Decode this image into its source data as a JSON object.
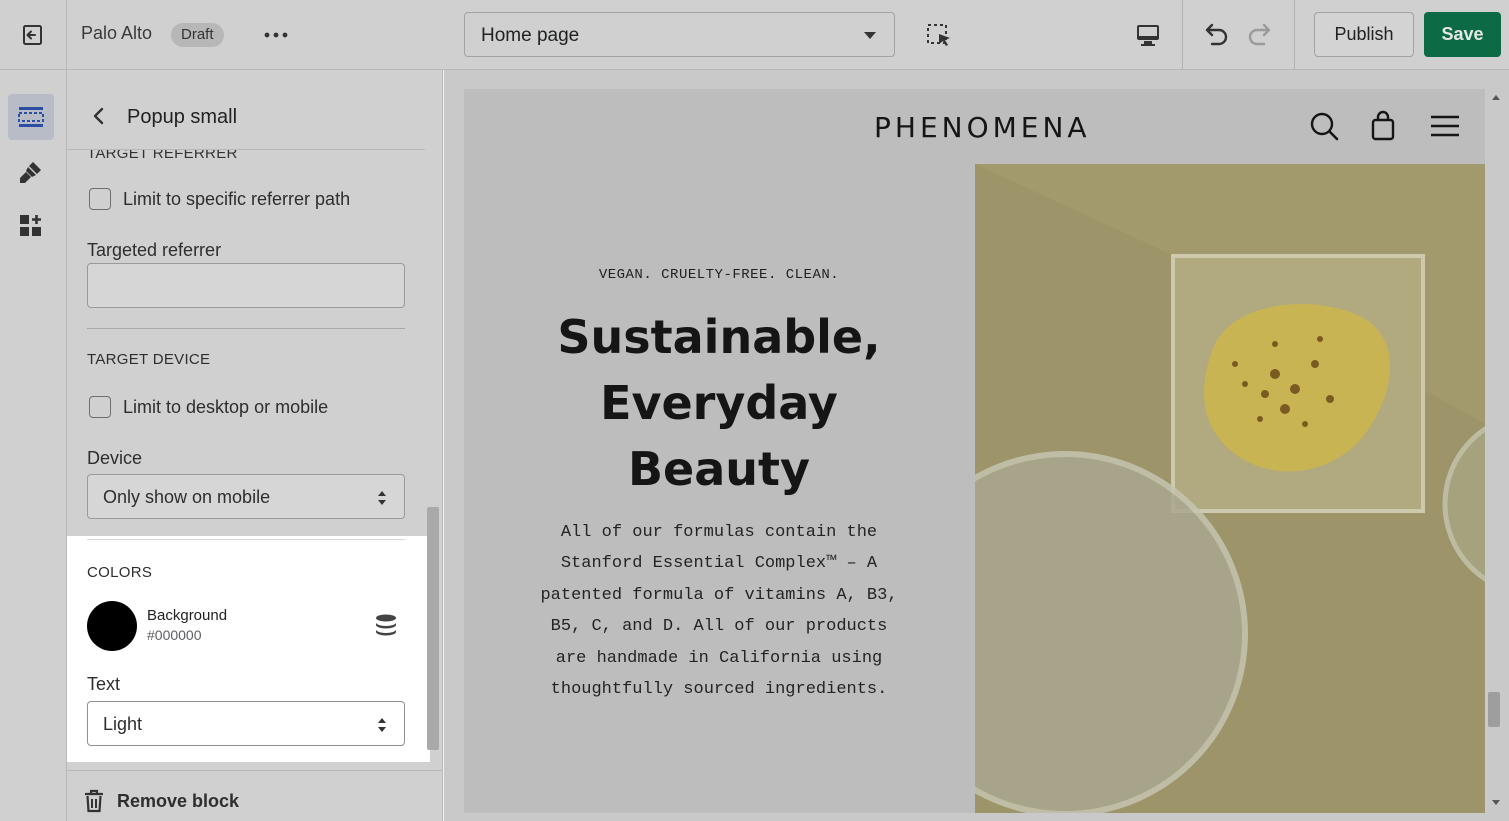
{
  "topbar": {
    "store_name": "Palo Alto",
    "status_badge": "Draft",
    "more_label": "•••",
    "page_selector": "Home page",
    "publish_label": "Publish",
    "save_label": "Save"
  },
  "leftrail": {
    "items": [
      "sections",
      "theme-settings",
      "app-embeds"
    ]
  },
  "sidebar": {
    "title": "Popup small",
    "cut_heading": "TARGET REFERRER",
    "referrer_checkbox_label": "Limit to specific referrer path",
    "targeted_referrer_label": "Targeted referrer",
    "targeted_referrer_value": "",
    "target_device_heading": "TARGET DEVICE",
    "device_checkbox_label": "Limit to desktop or mobile",
    "device_label": "Device",
    "device_value": "Only show on mobile",
    "colors_heading": "COLORS",
    "background_label": "Background",
    "background_hex": "#000000",
    "text_label": "Text",
    "text_value": "Light",
    "remove_label": "Remove block"
  },
  "preview": {
    "logo": "PHENOMENA",
    "tagline": "VEGAN. CRUELTY-FREE. CLEAN.",
    "heading_lines": [
      "Sustainable,",
      "Everyday",
      "Beauty"
    ],
    "body_lines": [
      "All of our formulas contain the",
      "Stanford Essential Complex™ – A",
      "patented formula of vitamins A, B3,",
      "B5, C, and D. All of our products",
      "are handmade in California using",
      "thoughtfully sourced ingredients."
    ]
  },
  "colors": {
    "save_green": "#0c6b45",
    "swatch": "#000000"
  }
}
